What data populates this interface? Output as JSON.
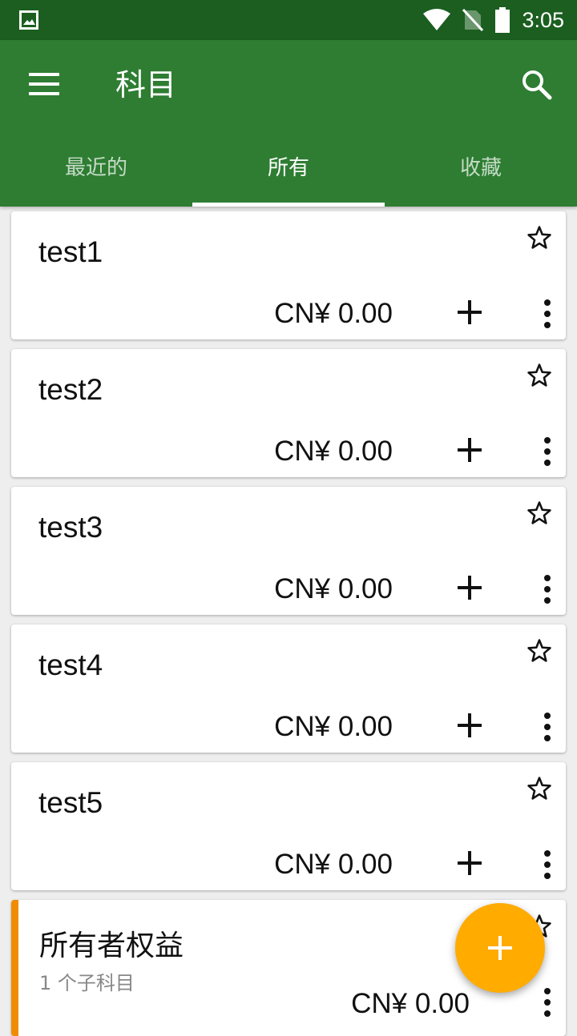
{
  "status_bar": {
    "time": "3:05"
  },
  "app_bar": {
    "title": "科目"
  },
  "tabs": [
    {
      "label": "最近的",
      "active": false
    },
    {
      "label": "所有",
      "active": true
    },
    {
      "label": "收藏",
      "active": false
    }
  ],
  "accounts": [
    {
      "name": "test1",
      "balance": "CN¥ 0.00"
    },
    {
      "name": "test2",
      "balance": "CN¥ 0.00"
    },
    {
      "name": "test3",
      "balance": "CN¥ 0.00"
    },
    {
      "name": "test4",
      "balance": "CN¥ 0.00"
    },
    {
      "name": "test5",
      "balance": "CN¥ 0.00"
    }
  ],
  "equity_account": {
    "name": "所有者权益",
    "subtitle": "1 个子科目",
    "balance": "CN¥ 0.00",
    "accent_color": "#f08c00"
  },
  "colors": {
    "status_bar": "#1b5e20",
    "app_bar": "#2e7d32",
    "fab": "#ffab00"
  },
  "icons": [
    "gallery-icon",
    "wifi-icon",
    "no-sim-icon",
    "battery-icon",
    "menu-icon",
    "search-icon",
    "star-outline-icon",
    "plus-icon",
    "more-vert-icon"
  ]
}
